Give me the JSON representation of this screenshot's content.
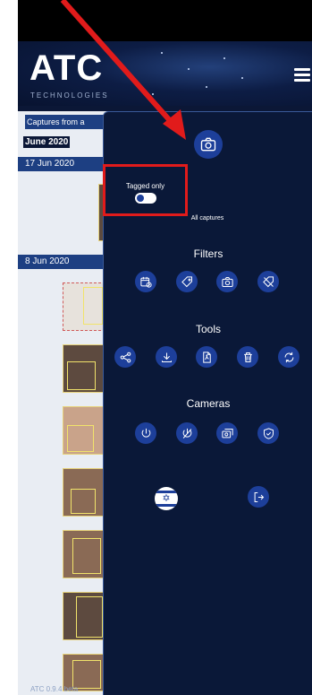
{
  "header": {
    "logo": "ATC",
    "logo_sub": "TECHNOLOGIES"
  },
  "captures": {
    "title": "Captures from a",
    "month": "June 2020",
    "days": [
      "17 Jun 2020",
      "8 Jun 2020"
    ]
  },
  "menu": {
    "tagged_only_label": "Tagged only",
    "all_captures_label": "All captures",
    "filters_title": "Filters",
    "tools_title": "Tools",
    "cameras_title": "Cameras"
  },
  "footer": {
    "version": "ATC 0.9.4 beta"
  },
  "colors": {
    "accent": "#1d3f9a",
    "highlight": "#e11b1b",
    "background": "#0a1838"
  }
}
